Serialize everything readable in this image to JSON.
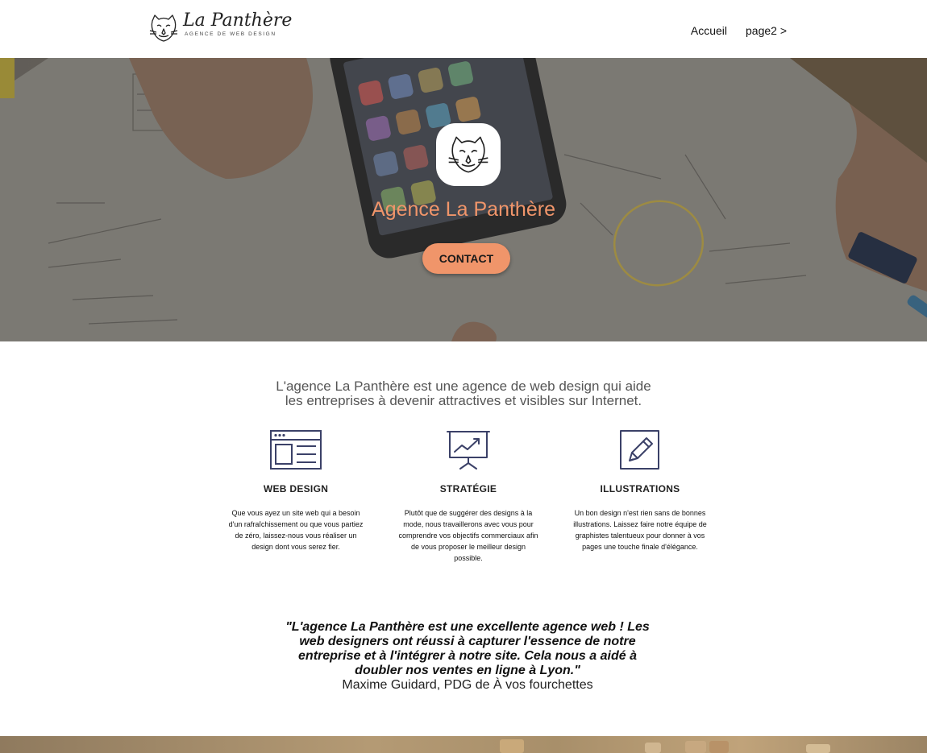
{
  "header": {
    "logo_title": "La Panthère",
    "logo_subtitle": "AGENCE DE WEB DESIGN",
    "nav": [
      {
        "label": "Accueil"
      },
      {
        "label": "page2 >"
      }
    ]
  },
  "hero": {
    "title": "Agence La Panthère",
    "contact_label": "CONTACT",
    "accent_color": "#f0956a"
  },
  "intro": {
    "line1": "L'agence La Panthère est une agence de web design qui aide",
    "line2": "les entreprises à devenir attractives et visibles sur Internet."
  },
  "services": [
    {
      "icon": "browser-window-icon",
      "title": "WEB DESIGN",
      "lines": [
        "Que vous ayez un site web qui a besoin",
        "d'un rafraîchissement ou que vous partiez",
        "de zéro, laissez-nous vous réaliser un",
        "design dont vous serez fier."
      ]
    },
    {
      "icon": "presentation-chart-icon",
      "title": "STRATÉGIE",
      "lines": [
        "Plutôt que de suggérer des designs à la",
        "mode, nous travaillerons avec vous pour",
        "comprendre vos objectifs commerciaux afin",
        "de vous proposer le meilleur design",
        "possible."
      ]
    },
    {
      "icon": "pencil-square-icon",
      "title": "ILLUSTRATIONS",
      "lines": [
        "Un bon design n'est rien sans de bonnes",
        "illustrations. Laissez faire notre équipe de",
        "graphistes talentueux pour donner à vos",
        "pages une touche finale d'élégance."
      ]
    }
  ],
  "testimonial": {
    "lines": [
      "\"L'agence La Panthère est une excellente agence web ! Les",
      "web designers ont réussi à capturer l'essence de notre",
      "entreprise et à l'intégrer à notre site. Cela nous a aidé à",
      "doubler nos ventes en ligne à Lyon.\""
    ],
    "author": "Maxime Guidard, PDG de À vos fourchettes"
  }
}
